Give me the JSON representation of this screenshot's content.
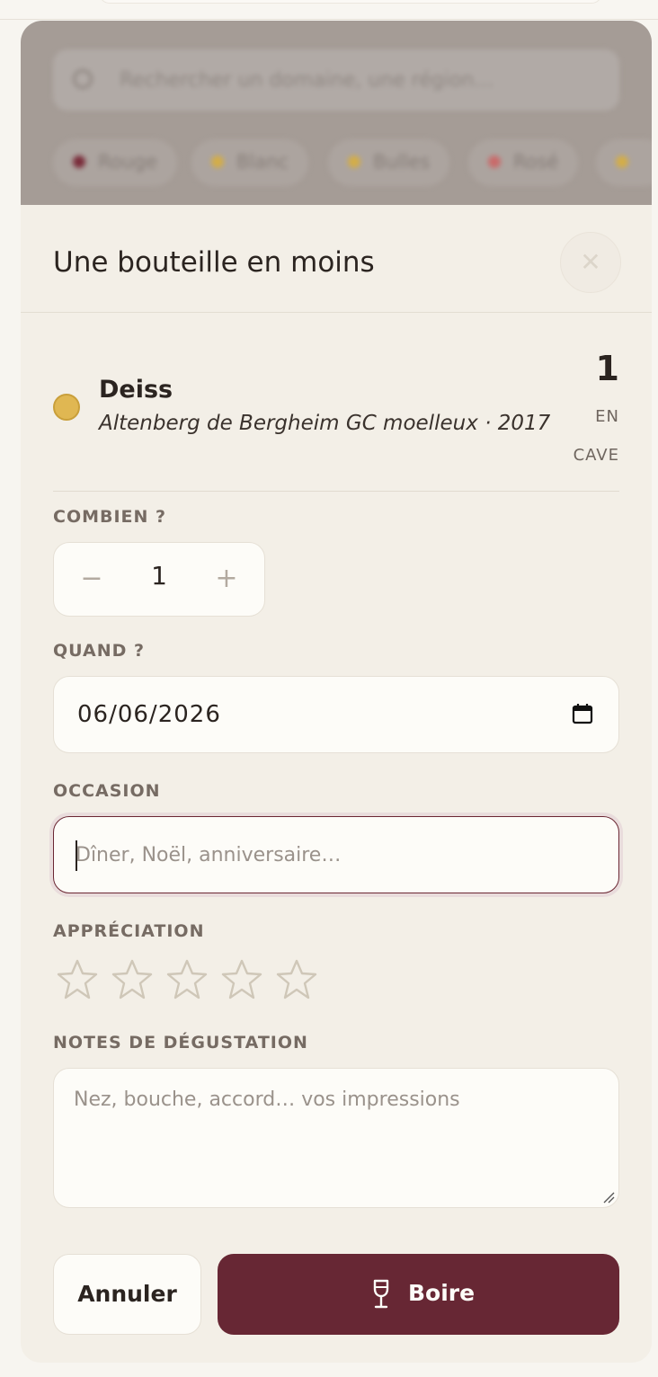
{
  "background": {
    "search_placeholder": "Rechercher un domaine, une région…",
    "filters": [
      {
        "label": "Rouge",
        "color": "#7a2c3a"
      },
      {
        "label": "Blanc",
        "color": "#d3ad48"
      },
      {
        "label": "Bulles",
        "color": "#d3ad48"
      },
      {
        "label": "Rosé",
        "color": "#c96a6a"
      }
    ]
  },
  "modal": {
    "title": "Une bouteille en moins",
    "close_icon": "close-icon"
  },
  "wine": {
    "producer": "Deiss",
    "cuvee": "Altenberg de Bergheim GC moelleux · 2017",
    "color": "#e0b752",
    "stock_count": "1",
    "stock_label": "EN CAVE"
  },
  "form": {
    "quantity_label": "COMBIEN ?",
    "quantity_value": "1",
    "minus": "−",
    "plus": "+",
    "date_label": "QUAND ?",
    "date_value": "06/06/2026",
    "occasion_label": "OCCASION",
    "occasion_placeholder": "Dîner, Noël, anniversaire…",
    "rating_label": "APPRÉCIATION",
    "rating_value": 0,
    "rating_max": 5,
    "notes_label": "NOTES DE DÉGUSTATION",
    "notes_placeholder": "Nez, bouche, accord… vos impressions"
  },
  "actions": {
    "cancel": "Annuler",
    "drink": "Boire"
  },
  "colors": {
    "accent": "#672734",
    "sheet_bg": "#f3efe7",
    "star_outline": "#cfc7b8"
  }
}
